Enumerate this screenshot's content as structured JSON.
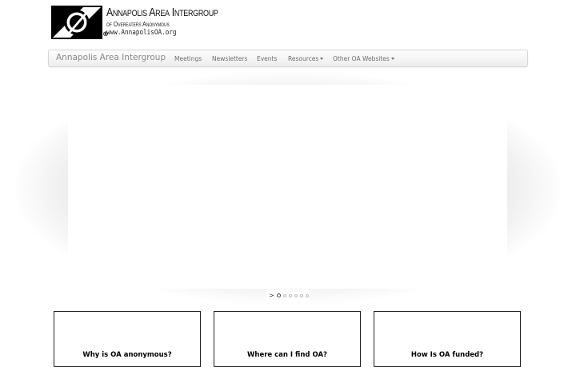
{
  "logo": {
    "title": "Annapolis Area Intergroup",
    "subtitle": "of Overeaters Anonymous",
    "url": "www.AnnapolisOA.org",
    "registered": "®",
    "icon": "oa-logo-icon"
  },
  "navbar": {
    "brand": "Annapolis Area Intergroup",
    "items": [
      {
        "label": "Meetings",
        "dropdown": false
      },
      {
        "label": "Newsletters",
        "dropdown": false
      },
      {
        "label": "Events",
        "dropdown": false
      },
      {
        "label": "Resources",
        "dropdown": true
      },
      {
        "label": "Other OA Websites",
        "dropdown": true
      }
    ]
  },
  "carousel": {
    "arrow": ">",
    "slide_count": 6,
    "active_index": 0
  },
  "cards": [
    {
      "title": "Why is OA anonymous?"
    },
    {
      "title": "Where can I find OA?"
    },
    {
      "title": "How Is OA funded?"
    }
  ],
  "colors": {
    "navbar_text": "#6e6e6e",
    "brand_text": "#8a8a8a",
    "card_border": "#222222"
  }
}
